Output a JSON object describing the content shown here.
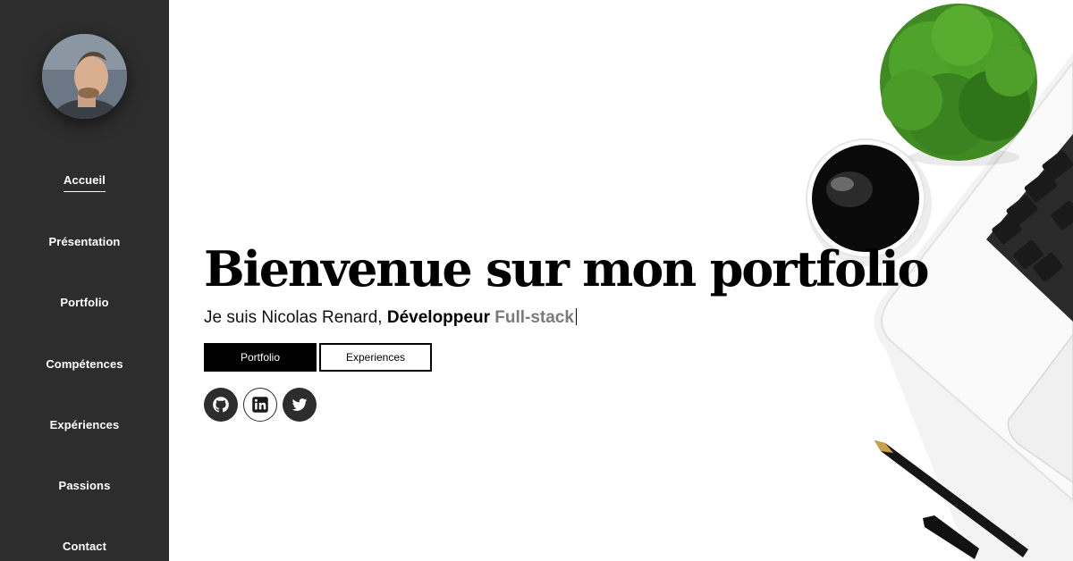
{
  "sidebar": {
    "avatar_icon": "profile-photo",
    "background": "#2d2d2d",
    "items": [
      {
        "label": "Accueil",
        "active": true
      },
      {
        "label": "Présentation"
      },
      {
        "label": "Portfolio"
      },
      {
        "label": "Compétences"
      },
      {
        "label": "Expériences"
      },
      {
        "label": "Passions"
      },
      {
        "label": "Contact"
      }
    ]
  },
  "hero": {
    "title": "Bienvenue sur mon portfolio",
    "intro": "Je suis Nicolas Renard, ",
    "role": "Développeur",
    "stack": "Full-stack"
  },
  "buttons": {
    "primary_label": "Portfolio",
    "secondary_label": "Experiences"
  },
  "social": [
    {
      "icon": "github-icon"
    },
    {
      "icon": "linkedin-icon"
    },
    {
      "icon": "twitter-icon"
    }
  ],
  "scene": {
    "icons": [
      "plant-icon",
      "coffee-cup-icon",
      "laptop-icon",
      "pen-icon"
    ]
  }
}
